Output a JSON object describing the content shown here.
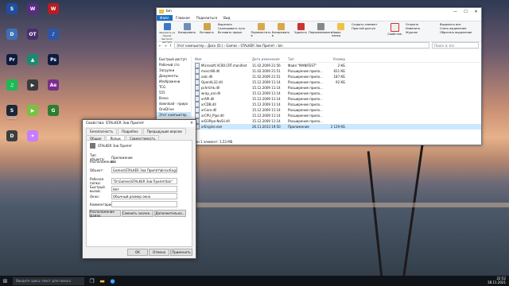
{
  "desktop": {
    "icons": [
      {
        "label": "",
        "color": "#1f4ea1",
        "glyph": "S"
      },
      {
        "label": "",
        "color": "#5b2a86",
        "glyph": "W"
      },
      {
        "label": "",
        "color": "#b81d24",
        "glyph": "W"
      },
      {
        "label": "",
        "color": "#3f6fb6",
        "glyph": "D"
      },
      {
        "label": "",
        "color": "#4a2f6e",
        "glyph": "OT"
      },
      {
        "label": "",
        "color": "#2d56a8",
        "glyph": "♪"
      },
      {
        "label": "",
        "color": "#0d1b40",
        "glyph": "Pr"
      },
      {
        "label": "",
        "color": "#1c8a70",
        "glyph": "▲"
      },
      {
        "label": "",
        "color": "#0d1b40",
        "glyph": "Ps"
      },
      {
        "label": "",
        "color": "#1db954",
        "glyph": "♫"
      },
      {
        "label": "",
        "color": "#3b3b3b",
        "glyph": "▶"
      },
      {
        "label": "",
        "color": "#7b2d8b",
        "glyph": "Ae"
      },
      {
        "label": "Steam",
        "color": "#1b2838",
        "glyph": "S"
      },
      {
        "label": "",
        "color": "#7ac142",
        "glyph": "▶"
      },
      {
        "label": "",
        "color": "#2e7d32",
        "glyph": "G"
      },
      {
        "label": "",
        "color": "#3e3e3e",
        "glyph": "D"
      },
      {
        "label": "",
        "color": "#c77dff",
        "glyph": "✦"
      }
    ]
  },
  "explorer": {
    "title": "bin",
    "tabs": [
      "Файл",
      "Главная",
      "Поделиться",
      "Вид"
    ],
    "active_tab": "Главная",
    "ribbon": {
      "pin_label": "Закрепить на панели быстрого доступа",
      "copy_label": "Копировать",
      "paste_label": "Вставить",
      "cut_label": "Вырезать",
      "copy_path_label": "Скопировать путь",
      "paste_shortcut_label": "Вставить ярлык",
      "move_label": "Переместить в",
      "copy_to_label": "Копировать в",
      "delete_label": "Удалить",
      "rename_label": "Переименовать",
      "new_folder_label": "Новая папка",
      "new_item_label": "Создать элемент",
      "easy_access_label": "Простой доступ",
      "properties_label": "Свойства",
      "open_label": "Открыть",
      "edit_label": "Изменить",
      "history_label": "Журнал",
      "select_all_label": "Выделить все",
      "select_none_label": "Снять выделение",
      "invert_label": "Обратить выделение"
    },
    "path": "Этот компьютер › Диск (D:) › Games › STALKER Зов Припят › bin",
    "search_placeholder": "Поиск в: bin",
    "nav": [
      {
        "label": "Быстрый доступ",
        "selected": false
      },
      {
        "label": "Рабочий сто",
        "selected": false
      },
      {
        "label": "Загрузки",
        "selected": false
      },
      {
        "label": "Документы",
        "selected": false
      },
      {
        "label": "Изображени",
        "selected": false
      },
      {
        "label": "TCG",
        "selected": false
      },
      {
        "label": "555",
        "selected": false
      },
      {
        "label": "Bravo",
        "selected": false
      },
      {
        "label": "download - приро",
        "selected": false
      },
      {
        "label": "OneDrive",
        "selected": false
      },
      {
        "label": "Этот компьютер",
        "selected": true
      }
    ],
    "columns": [
      "Имя",
      "Дата изменения",
      "Тип",
      "Размер"
    ],
    "files": [
      {
        "name": "Microsoft.VC80.CRT.manifest",
        "date": "11.02.2009 21:56",
        "type": "Файл \"MANIFEST\"",
        "size": "2 КБ",
        "selected": false
      },
      {
        "name": "msvcr80.dll",
        "date": "11.02.2009 21:51",
        "type": "Расширение прило...",
        "size": "621 КБ",
        "selected": false
      },
      {
        "name": "oalc.dll",
        "date": "11.02.2009 21:51",
        "type": "Расширение прило...",
        "size": "187 КБ",
        "selected": false
      },
      {
        "name": "OpenAL32.dll",
        "date": "15.12.2009 11:14",
        "type": "Расширение прило...",
        "size": "92 КБ",
        "selected": false
      },
      {
        "name": "pchrlchk.dll",
        "date": "15.12.2009 11:14",
        "type": "Расширение прило...",
        "size": "",
        "selected": false
      },
      {
        "name": "wrap_oal.dll",
        "date": "15.12.2009 11:14",
        "type": "Расширение прило...",
        "size": "",
        "selected": false
      },
      {
        "name": "xrAPI.dll",
        "date": "15.12.2009 11:14",
        "type": "Расширение прило...",
        "size": "",
        "selected": false
      },
      {
        "name": "xrCDB.dll",
        "date": "15.12.2009 11:14",
        "type": "Расширение прило...",
        "size": "",
        "selected": false
      },
      {
        "name": "xrCore.dll",
        "date": "15.12.2009 11:14",
        "type": "Расширение прило...",
        "size": "",
        "selected": false
      },
      {
        "name": "xrCPU_Pipe.dll",
        "date": "15.12.2009 11:14",
        "type": "Расширение прило...",
        "size": "",
        "selected": false
      },
      {
        "name": "xrD3Pipe-NoSli.dll",
        "date": "15.12.2009 11:14",
        "type": "Расширение прило...",
        "size": "",
        "selected": false
      },
      {
        "name": "xrEngine.exe",
        "date": "26.11.2013 19:50",
        "type": "Приложение",
        "size": "2 129 КБ",
        "selected": true
      }
    ],
    "status_count": "Элементов: 35",
    "status_selected": "Выбран 1 элемент: 1,53 МБ"
  },
  "properties": {
    "title": "Свойства: STALKER Зов Припят",
    "tabs_row1": [
      "Безопасность",
      "Подробно",
      "Предыдущие версии"
    ],
    "tabs_row2": [
      "Общие",
      "Ярлык",
      "Совместимость"
    ],
    "active_tab": "Ярлык",
    "name": "STALKER Зов Припят",
    "type_label": "Тип объекта:",
    "type_value": "Приложение",
    "location_label": "Расположение:",
    "location_value": "bin",
    "object_label": "Объект:",
    "object_value": "Games\\STALKER Зов Припят\\bin\\xrEngine.exe\"",
    "workdir_label": "Рабочая папка:",
    "workdir_value": "\"D:\\Games\\STALKER Зов Припят\\bin\"",
    "hotkey_label": "Быстрый вызов:",
    "hotkey_value": "Нет",
    "window_label": "Окно:",
    "window_value": "Обычный размер окна",
    "comment_label": "Комментарий:",
    "comment_value": "",
    "open_location_btn": "Расположение файла",
    "change_icon_btn": "Сменить значок...",
    "advanced_btn": "Дополнительно...",
    "ok_btn": "ОК",
    "cancel_btn": "Отмена",
    "apply_btn": "Применить"
  },
  "taskbar": {
    "search_placeholder": "Введите здесь текст для поиска",
    "time": "22:52",
    "date": "28.11.2021"
  }
}
